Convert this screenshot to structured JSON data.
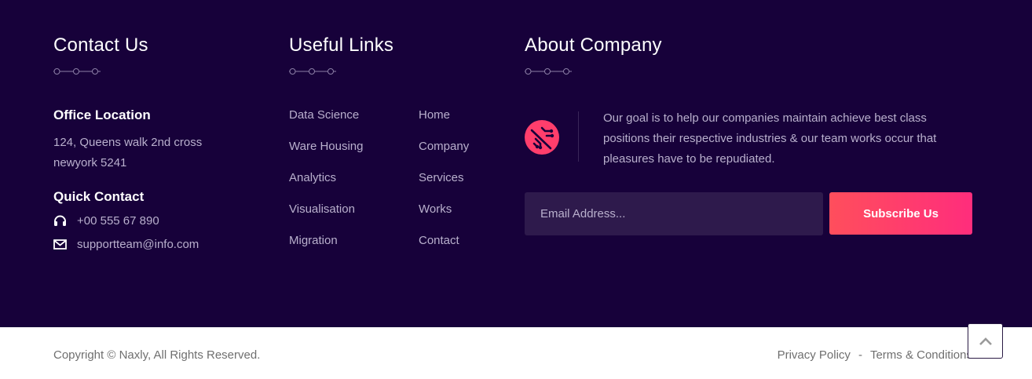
{
  "contact": {
    "title": "Contact Us",
    "office_title": "Office Location",
    "address_line1": "124, Queens walk 2nd cross",
    "address_line2": "newyork 5241",
    "quick_title": "Quick Contact",
    "phone": "+00 555 67 890",
    "email": "supportteam@info.com"
  },
  "links": {
    "title": "Useful Links",
    "column1": [
      "Data Science",
      "Ware Housing",
      "Analytics",
      "Visualisation",
      "Migration"
    ],
    "column2": [
      "Home",
      "Company",
      "Services",
      "Works",
      "Contact"
    ]
  },
  "about": {
    "title": "About Company",
    "text": "Our goal is to help our companies maintain achieve best class positions their respective industries & our team works occur that pleasures have to be repudiated.",
    "email_placeholder": "Email Address...",
    "subscribe_label": "Subscribe Us"
  },
  "bottom": {
    "copyright": "Copyright © Naxly, All Rights Reserved.",
    "privacy": "Privacy Policy",
    "separator": "-",
    "terms": "Terms & Conditions"
  },
  "icons": {
    "divider": "dots-divider-icon",
    "phone": "headphones-icon",
    "email": "envelope-icon",
    "brand": "circuit-logo-icon",
    "scroll": "chevron-up-icon"
  },
  "colors": {
    "footer_bg": "#17013a",
    "accent_start": "#ff4e5c",
    "accent_end": "#ff2d7c",
    "muted_text": "#b9b0cd",
    "input_bg": "#2e1a4c"
  }
}
